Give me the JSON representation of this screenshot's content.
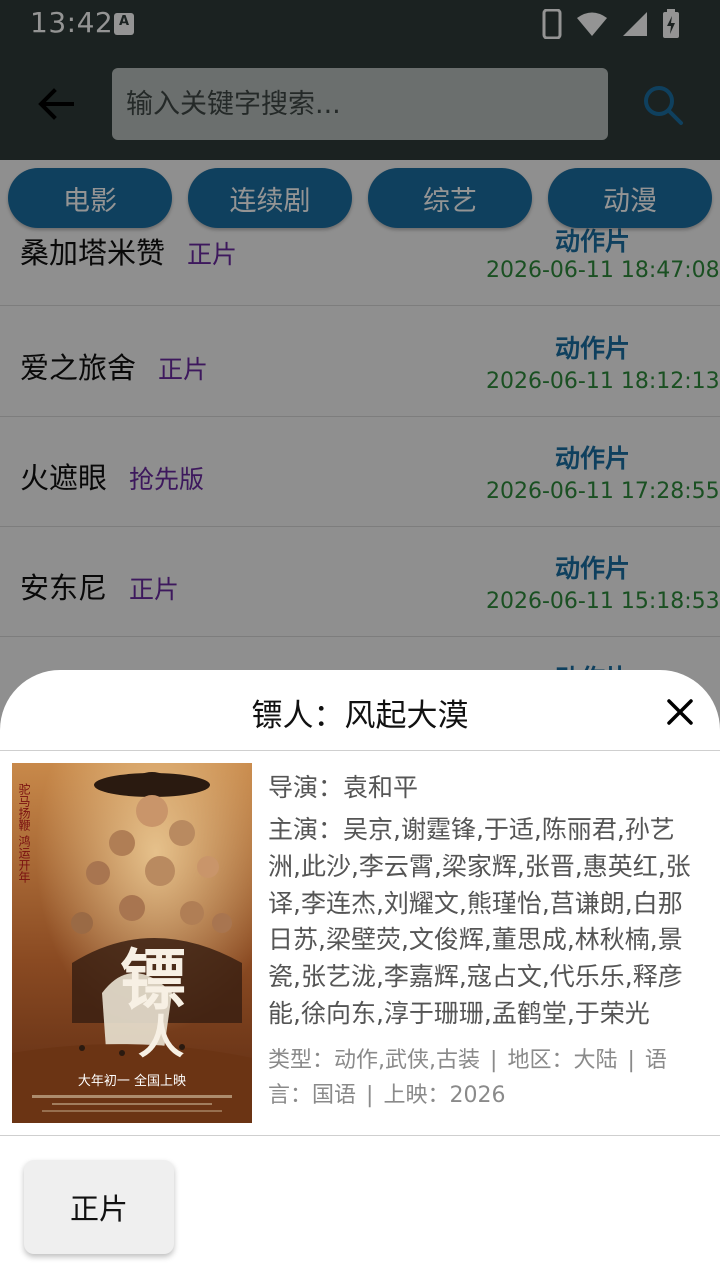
{
  "status_bar": {
    "time": "13:42",
    "notification_letter": "A"
  },
  "search": {
    "placeholder": "输入关键字搜索..."
  },
  "categories": [
    {
      "label": "电影"
    },
    {
      "label": "连续剧"
    },
    {
      "label": "综艺"
    },
    {
      "label": "动漫"
    }
  ],
  "list": [
    {
      "title": "桑加塔米赞",
      "badge": "正片",
      "genre": "动作片",
      "time": "2026-06-11 18:47:08"
    },
    {
      "title": "爱之旅舍",
      "badge": "正片",
      "genre": "动作片",
      "time": "2026-06-11 18:12:13"
    },
    {
      "title": "火遮眼",
      "badge": "抢先版",
      "genre": "动作片",
      "time": "2026-06-11 17:28:55"
    },
    {
      "title": "安东尼",
      "badge": "正片",
      "genre": "动作片",
      "time": "2026-06-11 15:18:53"
    },
    {
      "title": "",
      "badge": "",
      "genre": "动作片",
      "time": ""
    }
  ],
  "detail": {
    "title": "镖人：风起大漠",
    "director_label": "导演：",
    "director": "袁和平",
    "cast_label": "主演：",
    "cast": "吴京,谢霆锋,于适,陈丽君,孙艺洲,此沙,李云霄,梁家辉,张晋,惠英红,张译,李连杰,刘耀文,熊瑾怡,莒谦朗,白那日苏,梁壁荧,文俊辉,董思成,林秋楠,景瓷,张艺泷,李嘉辉,寇占文,代乐乐,释彦能,徐向东,淳于珊珊,孟鹤堂,于荣光",
    "type_label": "类型：",
    "type": "动作,武侠,古装",
    "region_label": "地区：",
    "region": "大陆",
    "language_label": "语言：",
    "language": "国语",
    "release_label": "上映：",
    "release": "2026",
    "separator": "|",
    "poster": {
      "big_char": "镖",
      "small_char": "人",
      "side_text": "驼马扬鞭 鸿运开年",
      "tagline": "大年初一 全国上映"
    },
    "play_label": "正片"
  },
  "colors": {
    "appbar": "#2f3c39",
    "category": "#1a6fa3",
    "badge": "#6a2aa0",
    "genre": "#1a6fa3",
    "time": "#2e8b3c"
  }
}
